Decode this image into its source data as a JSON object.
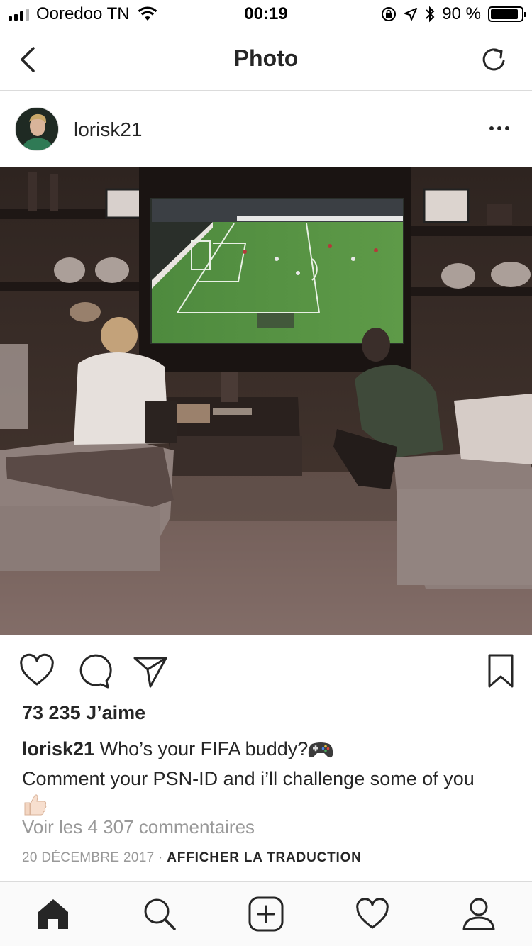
{
  "status_bar": {
    "carrier": "Ooredoo TN",
    "time": "00:19",
    "battery_percent": "90 %",
    "battery_level": 0.9
  },
  "nav": {
    "title": "Photo",
    "back_icon": "chevron-left-icon",
    "refresh_icon": "refresh-icon"
  },
  "post": {
    "username": "lorisk21",
    "likes": "73 235 J’aime",
    "caption_user": "lorisk21",
    "caption_line1": "Who’s your FIFA buddy?",
    "caption_line2": "Comment your PSN-ID and i’ll challenge some of you",
    "view_comments": "Voir les 4 307 commentaires",
    "date": "20 DÉCEMBRE 2017",
    "separator": "·",
    "translate": "AFFICHER LA TRADUCTION"
  },
  "tabs": [
    {
      "icon": "home-icon"
    },
    {
      "icon": "search-icon"
    },
    {
      "icon": "add-post-icon"
    },
    {
      "icon": "heart-icon"
    },
    {
      "icon": "profile-icon"
    }
  ],
  "colors": {
    "text": "#262626",
    "muted": "#999999",
    "divider": "#dbdbdb"
  }
}
